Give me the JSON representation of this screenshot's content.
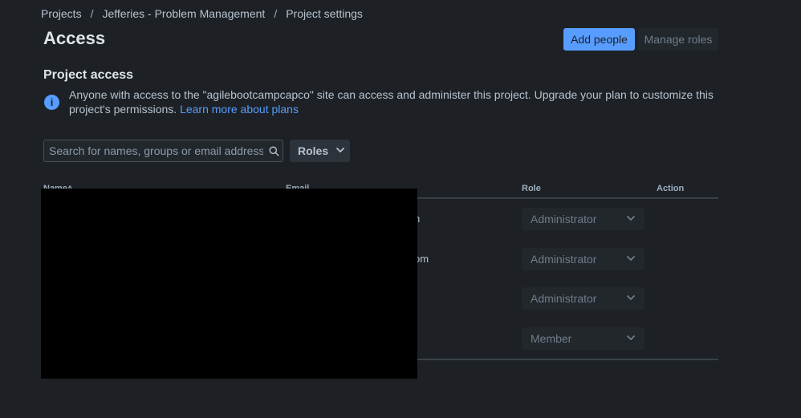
{
  "breadcrumb": {
    "items": [
      "Projects",
      "Jefferies - Problem Management",
      "Project settings"
    ],
    "separator": "/"
  },
  "page": {
    "title": "Access"
  },
  "actions": {
    "add_people": "Add people",
    "manage_roles": "Manage roles"
  },
  "project_access": {
    "title": "Project access",
    "info_icon": "info-icon",
    "message": "Anyone with access to the \"agilebootcampcapco\" site can access and administer this project. Upgrade your plan to customize this project's permissions.",
    "link": "Learn more about plans"
  },
  "filters": {
    "search_placeholder": "Search for names, groups or email addresses",
    "roles_label": "Roles"
  },
  "table": {
    "columns": {
      "name": "Name",
      "email": "Email",
      "role": "Role",
      "action": "Action"
    },
    "rows": [
      {
        "email_fragment": "n",
        "role": "Administrator"
      },
      {
        "email_fragment": "om",
        "role": "Administrator"
      },
      {
        "email_fragment": "",
        "role": "Administrator"
      },
      {
        "email_fragment": "",
        "role": "Member"
      }
    ]
  },
  "colors": {
    "background": "#1d2125",
    "primary": "#579dff",
    "text": "#b6c2cf",
    "redaction": "#000000"
  }
}
